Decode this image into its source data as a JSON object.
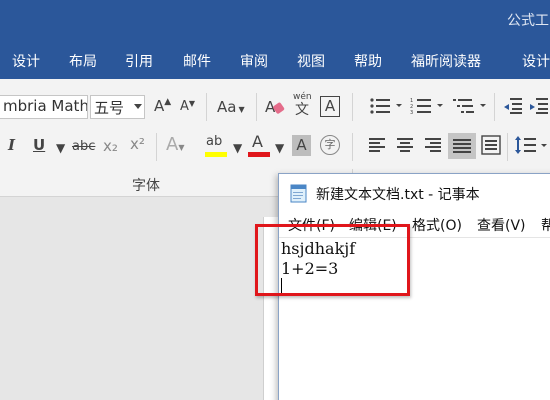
{
  "window": {
    "title_partial": "公式工"
  },
  "ribbon": {
    "tabs": [
      {
        "label": "设计"
      },
      {
        "label": "布局"
      },
      {
        "label": "引用"
      },
      {
        "label": "邮件"
      },
      {
        "label": "审阅"
      },
      {
        "label": "视图"
      },
      {
        "label": "帮助"
      },
      {
        "label": "福昕阅读器"
      },
      {
        "label": "设计"
      }
    ],
    "font": {
      "name_value": "mbria Math",
      "size_value": "五号",
      "group_label": "字体",
      "grow_font_label": "A",
      "shrink_font_label": "A",
      "change_case_label": "Aa",
      "phonetic_main": "文",
      "phonetic_top": "wén",
      "char_border_label": "A",
      "italic_label": "I",
      "underline_label": "U",
      "strikethrough_label": "abc",
      "subscript_label": "x₂",
      "superscript_label": "x²",
      "text_effects_label": "A",
      "highlight_label": "ab",
      "font_color_label": "A",
      "char_shading_label": "A",
      "enclose_char_label": "字"
    },
    "colors": {
      "highlight_bar": "#ffff00",
      "font_color_bar": "#e0161b"
    }
  },
  "notepad": {
    "title": "新建文本文档.txt - 记事本",
    "menu": [
      {
        "label": "文件(F)"
      },
      {
        "label": "编辑(E)"
      },
      {
        "label": "格式(O)"
      },
      {
        "label": "查看(V)"
      },
      {
        "label": "帮"
      }
    ],
    "lines": [
      "hsjdhakjf",
      "1+2=3"
    ]
  },
  "accent": "#2b579a",
  "highlight_color": "#e0161b"
}
